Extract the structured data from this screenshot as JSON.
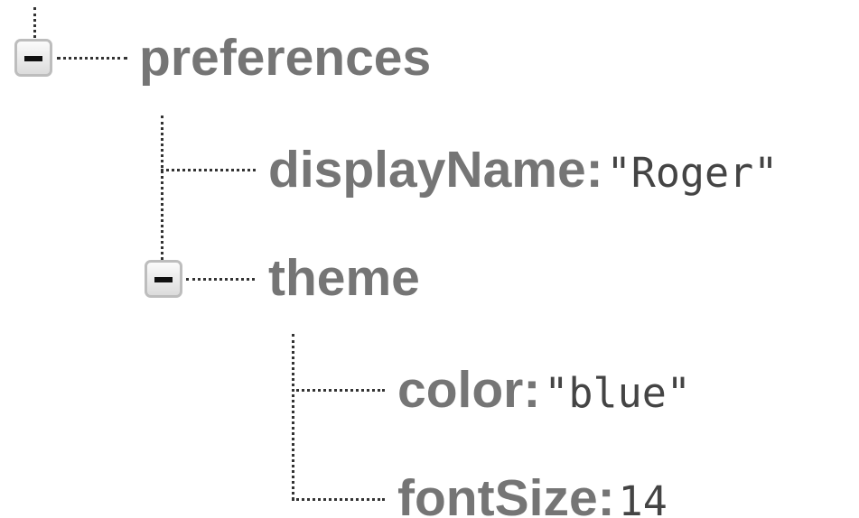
{
  "tree": {
    "root": {
      "key": "preferences",
      "expanded": true,
      "children": [
        {
          "key": "displayName:",
          "value": "\"Roger\""
        },
        {
          "key": "theme",
          "expanded": true,
          "children": [
            {
              "key": "color:",
              "value": "\"blue\""
            },
            {
              "key": "fontSize:",
              "value": "14"
            }
          ]
        }
      ]
    }
  },
  "icons": {
    "collapse": "minus-box-icon"
  },
  "colors": {
    "key_text": "#757575",
    "value_text": "#444444",
    "connector": "#333333",
    "toggle_border": "#bdbdbd"
  }
}
